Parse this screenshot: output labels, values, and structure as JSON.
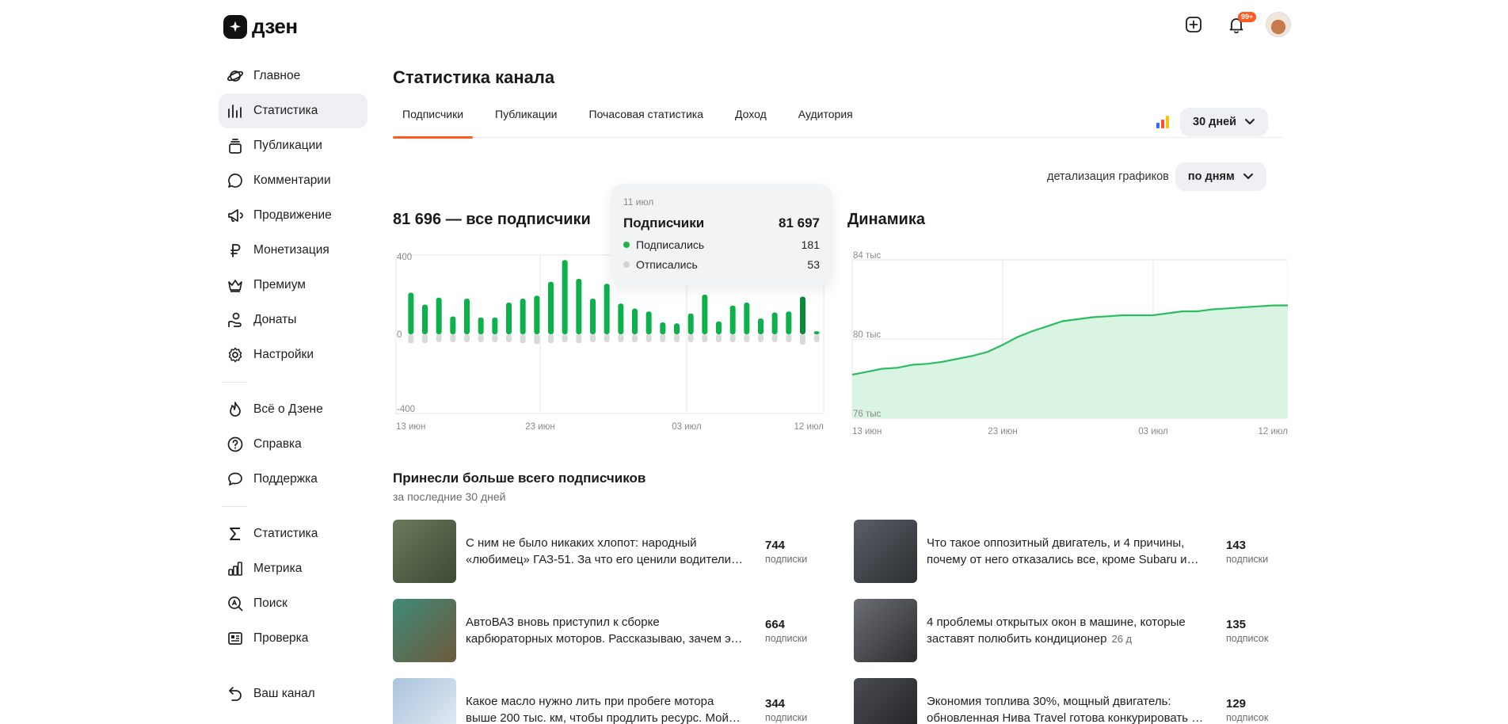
{
  "app": {
    "logo_text": "дзен"
  },
  "header": {
    "notifications_badge": "99+",
    "icons": [
      "plus-square-icon",
      "bell-icon",
      "avatar"
    ]
  },
  "sidebar": {
    "items": [
      {
        "label": "Главное",
        "icon": "planet-icon"
      },
      {
        "label": "Статистика",
        "icon": "bar-stats-icon",
        "active": true
      },
      {
        "label": "Публикации",
        "icon": "stack-icon"
      },
      {
        "label": "Комментарии",
        "icon": "comment-icon"
      },
      {
        "label": "Продвижение",
        "icon": "megaphone-icon"
      },
      {
        "label": "Монетизация",
        "icon": "ruble-icon"
      },
      {
        "label": "Премиум",
        "icon": "crown-icon"
      },
      {
        "label": "Донаты",
        "icon": "donate-icon"
      },
      {
        "label": "Настройки",
        "icon": "gear-icon"
      }
    ],
    "items2": [
      {
        "label": "Всё о Дзене",
        "icon": "flame-icon"
      },
      {
        "label": "Справка",
        "icon": "help-icon"
      },
      {
        "label": "Поддержка",
        "icon": "chat-icon"
      }
    ],
    "items3": [
      {
        "label": "Статистика",
        "icon": "sigma-icon"
      },
      {
        "label": "Метрика",
        "icon": "metrika-icon"
      },
      {
        "label": "Поиск",
        "icon": "search-a-icon"
      },
      {
        "label": "Проверка",
        "icon": "check-card-icon"
      }
    ],
    "channel": {
      "label": "Ваш канал",
      "icon": "back-arrow-icon"
    }
  },
  "main": {
    "title": "Статистика канала",
    "tabs": [
      {
        "label": "Подписчики",
        "active": true
      },
      {
        "label": "Публикации"
      },
      {
        "label": "Почасовая статистика"
      },
      {
        "label": "Доход"
      },
      {
        "label": "Аудитория"
      }
    ],
    "period": "30 дней",
    "detail_label": "детализация графиков",
    "detail_value": "по дням"
  },
  "tooltip": {
    "date": "11 июл",
    "title": "Подписчики",
    "total": "81 697",
    "rows": [
      {
        "label": "Подписались",
        "value": "181",
        "color": "#22b24c"
      },
      {
        "label": "Отписались",
        "value": "53",
        "color": "#d4d4d4"
      }
    ]
  },
  "chart_data": [
    {
      "type": "bar",
      "title": "81 696 — все подписчики",
      "ylim": [
        -400,
        400
      ],
      "yticks": [
        "400",
        "0",
        "-400"
      ],
      "xticks": [
        "13 июн",
        "23 июн",
        "03 июл",
        "12 июл"
      ],
      "grid": true,
      "highlighted_index": 28,
      "colors": {
        "subscribed": "#0db14b",
        "highlight": "#0a8a3c",
        "unsubscribed": "#d9d9d9"
      },
      "series": [
        {
          "name": "Подписались",
          "values": [
            210,
            150,
            185,
            90,
            180,
            85,
            85,
            160,
            180,
            195,
            265,
            375,
            280,
            180,
            255,
            155,
            130,
            115,
            60,
            55,
            105,
            200,
            65,
            145,
            160,
            80,
            110,
            115,
            190,
            15
          ]
        },
        {
          "name": "Отписались",
          "values": [
            -45,
            -45,
            -40,
            -40,
            -40,
            -40,
            -40,
            -40,
            -45,
            -50,
            -45,
            -40,
            -45,
            -40,
            -40,
            -40,
            -40,
            -40,
            -40,
            -40,
            -40,
            -40,
            -40,
            -40,
            -40,
            -40,
            -40,
            -40,
            -53,
            -40
          ]
        }
      ]
    },
    {
      "type": "area",
      "title": "Динамика",
      "ylim": [
        76000,
        84000
      ],
      "yticks": [
        "84 тыс",
        "80 тыс",
        "76 тыс"
      ],
      "xticks": [
        "13 июн",
        "23 июн",
        "03 июл",
        "12 июл"
      ],
      "grid": true,
      "colors": {
        "line": "#2bbd5f",
        "fill": "#d9f4e2"
      },
      "values": [
        78200,
        78350,
        78500,
        78550,
        78700,
        78750,
        78850,
        79000,
        79150,
        79350,
        79700,
        80100,
        80400,
        80650,
        80900,
        81000,
        81100,
        81150,
        81200,
        81200,
        81200,
        81300,
        81400,
        81400,
        81500,
        81550,
        81600,
        81650,
        81697,
        81700
      ]
    }
  ],
  "top_posts": {
    "title": "Принесли больше всего подписчиков",
    "subtitle": "за последние 30 дней",
    "items": [
      {
        "text": "С ним не было никаких хлопот: народный «любимец» ГАЗ-51. За что его ценили водители в СССР",
        "age": "",
        "count": "744",
        "unit": "подписки",
        "thumb": [
          "#6a7a5a",
          "#3d4a35"
        ]
      },
      {
        "text": "Что такое оппозитный двигатель, и 4 причины, почему от него отказались все, кроме Subaru и Porsche",
        "age": "",
        "count": "143",
        "unit": "подписки",
        "thumb": [
          "#5a5f66",
          "#2c2f33"
        ]
      },
      {
        "text": "АвтоВАЗ вновь приступил к сборке карбюраторных моторов. Рассказываю, зачем это делают",
        "age": "",
        "count": "664",
        "unit": "подписки",
        "thumb": [
          "#3f8a78",
          "#6d5a3c"
        ]
      },
      {
        "text": "4 проблемы открытых окон в машине, которые заставят полюбить кондиционер",
        "age": "26 д",
        "count": "135",
        "unit": "подписок",
        "thumb": [
          "#6b6e73",
          "#2b2d30"
        ]
      },
      {
        "text": "Какое масло нужно лить при пробеге мотора выше 200 тыс. км, чтобы продлить ресурс. Мой опыт",
        "age": "",
        "count": "344",
        "unit": "подписки",
        "thumb": [
          "#a9c3dd",
          "#e8eef4"
        ]
      },
      {
        "text": "Экономия топлива 30%, мощный двигатель: обновленная Нива Travel готова конкурировать с иномарками",
        "age": "",
        "count": "129",
        "unit": "подписок",
        "thumb": [
          "#4a4d52",
          "#1f2124"
        ]
      }
    ]
  }
}
